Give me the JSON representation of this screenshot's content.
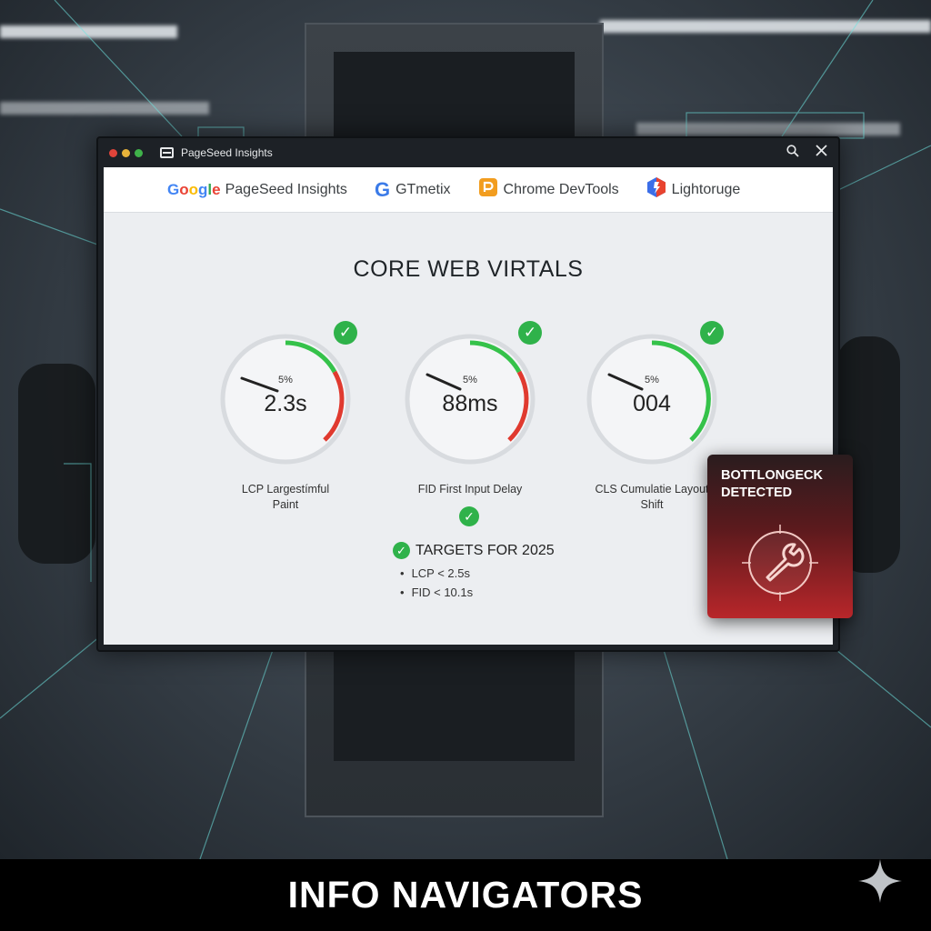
{
  "window": {
    "tab_title": "PageSeed Insights",
    "search_icon": "search-icon",
    "close_icon": "close-icon"
  },
  "tools": [
    {
      "label": "Google PageSeed Insights",
      "icon": "google-logo"
    },
    {
      "label": "GTmetix",
      "icon": "gtmetrix-logo"
    },
    {
      "label": "Chrome DevTools",
      "icon": "devtools-logo"
    },
    {
      "label": "Lightoruge",
      "icon": "lighthouse-logo"
    }
  ],
  "main": {
    "title": "CORE WEB VIRTALS",
    "gauges": [
      {
        "pct": "5%",
        "value": "2.3s",
        "label_line1": "LCP Largestímful",
        "label_line2": "Paint",
        "status_color": "#e03a2f"
      },
      {
        "pct": "5%",
        "value": "88ms",
        "label_line1": "FID First Input Delay",
        "label_line2": "",
        "status_color": "#e03a2f"
      },
      {
        "pct": "5%",
        "value": "004",
        "label_line1": "CLS Cumulatie Layout",
        "label_line2": "Shift",
        "status_color": "#35c24a"
      }
    ],
    "targets": {
      "heading": "TARGETS FOR 2025",
      "items": [
        "LCP < 2.5s",
        "FID < 10.1s"
      ]
    }
  },
  "alert": {
    "line1": "BOTTLONGECK",
    "line2": "DETECTED",
    "icon": "wrench-icon"
  },
  "footer": {
    "brand": "INFO NAVIGATORS"
  },
  "colors": {
    "good": "#2fb24a",
    "bad": "#e03a2f",
    "alert": "#b8262a"
  }
}
